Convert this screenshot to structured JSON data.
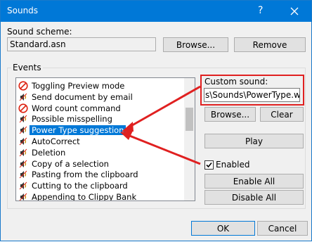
{
  "window": {
    "title": "Sounds",
    "help_glyph": "?",
    "close_glyph": "×"
  },
  "scheme": {
    "label": "Sound scheme:",
    "value": "Standard.asn",
    "browse_label": "Browse...",
    "remove_label": "Remove"
  },
  "events": {
    "group_label": "Events",
    "items": [
      {
        "label": "Toggling Preview mode",
        "icon": "no-sound-icon"
      },
      {
        "label": "Send document by email",
        "icon": "sound-icon"
      },
      {
        "label": "Word count command",
        "icon": "no-sound-icon"
      },
      {
        "label": "Possible misspelling",
        "icon": "sound-icon"
      },
      {
        "label": "Power Type suggestion",
        "icon": "sound-icon",
        "selected": true
      },
      {
        "label": "AutoCorrect",
        "icon": "sound-icon"
      },
      {
        "label": "Deletion",
        "icon": "sound-icon"
      },
      {
        "label": "Copy of a selection",
        "icon": "sound-icon"
      },
      {
        "label": "Pasting from the clipboard",
        "icon": "sound-icon"
      },
      {
        "label": "Cutting to the clipboard",
        "icon": "sound-icon"
      },
      {
        "label": "Appending to Clippy Bank",
        "icon": "sound-icon"
      }
    ]
  },
  "custom": {
    "label": "Custom sound:",
    "value": "s\\Sounds\\PowerType.wav",
    "browse_label": "Browse...",
    "clear_label": "Clear",
    "play_label": "Play",
    "enabled_label": "Enabled",
    "enabled_checked": true,
    "enable_all_label": "Enable All",
    "disable_all_label": "Disable All"
  },
  "footer": {
    "ok_label": "OK",
    "cancel_label": "Cancel"
  },
  "colors": {
    "titlebar": "#0078d7",
    "highlight": "#e02020",
    "selection": "#0078d7"
  }
}
